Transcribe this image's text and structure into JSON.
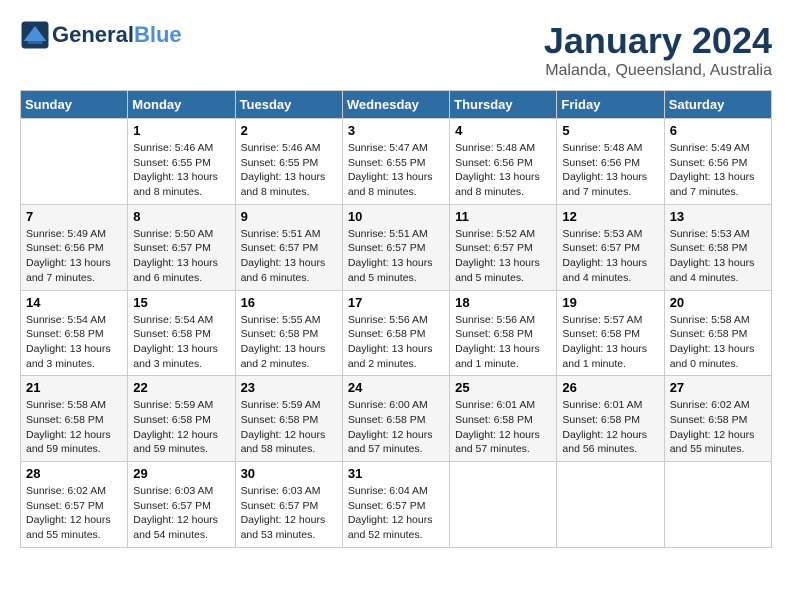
{
  "logo": {
    "line1": "General",
    "line2": "Blue"
  },
  "title": "January 2024",
  "subtitle": "Malanda, Queensland, Australia",
  "days_of_week": [
    "Sunday",
    "Monday",
    "Tuesday",
    "Wednesday",
    "Thursday",
    "Friday",
    "Saturday"
  ],
  "weeks": [
    [
      {
        "day": "",
        "info": ""
      },
      {
        "day": "1",
        "info": "Sunrise: 5:46 AM\nSunset: 6:55 PM\nDaylight: 13 hours\nand 8 minutes."
      },
      {
        "day": "2",
        "info": "Sunrise: 5:46 AM\nSunset: 6:55 PM\nDaylight: 13 hours\nand 8 minutes."
      },
      {
        "day": "3",
        "info": "Sunrise: 5:47 AM\nSunset: 6:55 PM\nDaylight: 13 hours\nand 8 minutes."
      },
      {
        "day": "4",
        "info": "Sunrise: 5:48 AM\nSunset: 6:56 PM\nDaylight: 13 hours\nand 8 minutes."
      },
      {
        "day": "5",
        "info": "Sunrise: 5:48 AM\nSunset: 6:56 PM\nDaylight: 13 hours\nand 7 minutes."
      },
      {
        "day": "6",
        "info": "Sunrise: 5:49 AM\nSunset: 6:56 PM\nDaylight: 13 hours\nand 7 minutes."
      }
    ],
    [
      {
        "day": "7",
        "info": "Sunrise: 5:49 AM\nSunset: 6:56 PM\nDaylight: 13 hours\nand 7 minutes."
      },
      {
        "day": "8",
        "info": "Sunrise: 5:50 AM\nSunset: 6:57 PM\nDaylight: 13 hours\nand 6 minutes."
      },
      {
        "day": "9",
        "info": "Sunrise: 5:51 AM\nSunset: 6:57 PM\nDaylight: 13 hours\nand 6 minutes."
      },
      {
        "day": "10",
        "info": "Sunrise: 5:51 AM\nSunset: 6:57 PM\nDaylight: 13 hours\nand 5 minutes."
      },
      {
        "day": "11",
        "info": "Sunrise: 5:52 AM\nSunset: 6:57 PM\nDaylight: 13 hours\nand 5 minutes."
      },
      {
        "day": "12",
        "info": "Sunrise: 5:53 AM\nSunset: 6:57 PM\nDaylight: 13 hours\nand 4 minutes."
      },
      {
        "day": "13",
        "info": "Sunrise: 5:53 AM\nSunset: 6:58 PM\nDaylight: 13 hours\nand 4 minutes."
      }
    ],
    [
      {
        "day": "14",
        "info": "Sunrise: 5:54 AM\nSunset: 6:58 PM\nDaylight: 13 hours\nand 3 minutes."
      },
      {
        "day": "15",
        "info": "Sunrise: 5:54 AM\nSunset: 6:58 PM\nDaylight: 13 hours\nand 3 minutes."
      },
      {
        "day": "16",
        "info": "Sunrise: 5:55 AM\nSunset: 6:58 PM\nDaylight: 13 hours\nand 2 minutes."
      },
      {
        "day": "17",
        "info": "Sunrise: 5:56 AM\nSunset: 6:58 PM\nDaylight: 13 hours\nand 2 minutes."
      },
      {
        "day": "18",
        "info": "Sunrise: 5:56 AM\nSunset: 6:58 PM\nDaylight: 13 hours\nand 1 minute."
      },
      {
        "day": "19",
        "info": "Sunrise: 5:57 AM\nSunset: 6:58 PM\nDaylight: 13 hours\nand 1 minute."
      },
      {
        "day": "20",
        "info": "Sunrise: 5:58 AM\nSunset: 6:58 PM\nDaylight: 13 hours\nand 0 minutes."
      }
    ],
    [
      {
        "day": "21",
        "info": "Sunrise: 5:58 AM\nSunset: 6:58 PM\nDaylight: 12 hours\nand 59 minutes."
      },
      {
        "day": "22",
        "info": "Sunrise: 5:59 AM\nSunset: 6:58 PM\nDaylight: 12 hours\nand 59 minutes."
      },
      {
        "day": "23",
        "info": "Sunrise: 5:59 AM\nSunset: 6:58 PM\nDaylight: 12 hours\nand 58 minutes."
      },
      {
        "day": "24",
        "info": "Sunrise: 6:00 AM\nSunset: 6:58 PM\nDaylight: 12 hours\nand 57 minutes."
      },
      {
        "day": "25",
        "info": "Sunrise: 6:01 AM\nSunset: 6:58 PM\nDaylight: 12 hours\nand 57 minutes."
      },
      {
        "day": "26",
        "info": "Sunrise: 6:01 AM\nSunset: 6:58 PM\nDaylight: 12 hours\nand 56 minutes."
      },
      {
        "day": "27",
        "info": "Sunrise: 6:02 AM\nSunset: 6:58 PM\nDaylight: 12 hours\nand 55 minutes."
      }
    ],
    [
      {
        "day": "28",
        "info": "Sunrise: 6:02 AM\nSunset: 6:57 PM\nDaylight: 12 hours\nand 55 minutes."
      },
      {
        "day": "29",
        "info": "Sunrise: 6:03 AM\nSunset: 6:57 PM\nDaylight: 12 hours\nand 54 minutes."
      },
      {
        "day": "30",
        "info": "Sunrise: 6:03 AM\nSunset: 6:57 PM\nDaylight: 12 hours\nand 53 minutes."
      },
      {
        "day": "31",
        "info": "Sunrise: 6:04 AM\nSunset: 6:57 PM\nDaylight: 12 hours\nand 52 minutes."
      },
      {
        "day": "",
        "info": ""
      },
      {
        "day": "",
        "info": ""
      },
      {
        "day": "",
        "info": ""
      }
    ]
  ]
}
